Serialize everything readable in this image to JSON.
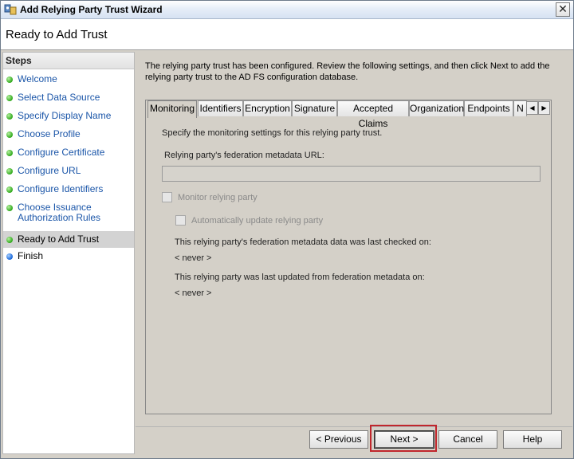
{
  "window": {
    "title": "Add Relying Party Trust Wizard",
    "close_glyph": "✕"
  },
  "header": {
    "title": "Ready to Add Trust"
  },
  "steps": {
    "heading": "Steps",
    "items": [
      {
        "label": "Welcome",
        "status": "done"
      },
      {
        "label": "Select Data Source",
        "status": "done"
      },
      {
        "label": "Specify Display Name",
        "status": "done"
      },
      {
        "label": "Choose Profile",
        "status": "done"
      },
      {
        "label": "Configure Certificate",
        "status": "done"
      },
      {
        "label": "Configure URL",
        "status": "done"
      },
      {
        "label": "Configure Identifiers",
        "status": "done"
      },
      {
        "label": "Choose Issuance Authorization Rules",
        "line1": "Choose Issuance",
        "line2": "Authorization Rules",
        "status": "done"
      },
      {
        "label": "Ready to Add Trust",
        "status": "current"
      },
      {
        "label": "Finish",
        "status": "pending"
      }
    ]
  },
  "content": {
    "intro_line1": "The relying party trust has been configured. Review the following settings, and then click Next to add the",
    "intro_line2": "relying party trust to the AD FS configuration database.",
    "tabs": [
      "Monitoring",
      "Identifiers",
      "Encryption",
      "Signature",
      "Accepted Claims",
      "Organization",
      "Endpoints",
      "N"
    ],
    "active_tab": "Monitoring",
    "monitoring": {
      "description": "Specify the monitoring settings for this relying party trust.",
      "url_label": "Relying party's federation metadata URL:",
      "url_value": "",
      "monitor_checkbox": "Monitor relying party",
      "auto_update_checkbox": "Automatically update relying party",
      "last_checked_label": "This relying party's federation metadata data was last checked on:",
      "last_checked_value": "< never >",
      "last_updated_label": "This relying party was last updated from federation metadata on:",
      "last_updated_value": "< never >"
    }
  },
  "buttons": {
    "previous": "< Previous",
    "next": "Next >",
    "cancel": "Cancel",
    "help": "Help"
  },
  "colors": {
    "step_link": "#1a55a8",
    "highlight": "#c0262c"
  }
}
